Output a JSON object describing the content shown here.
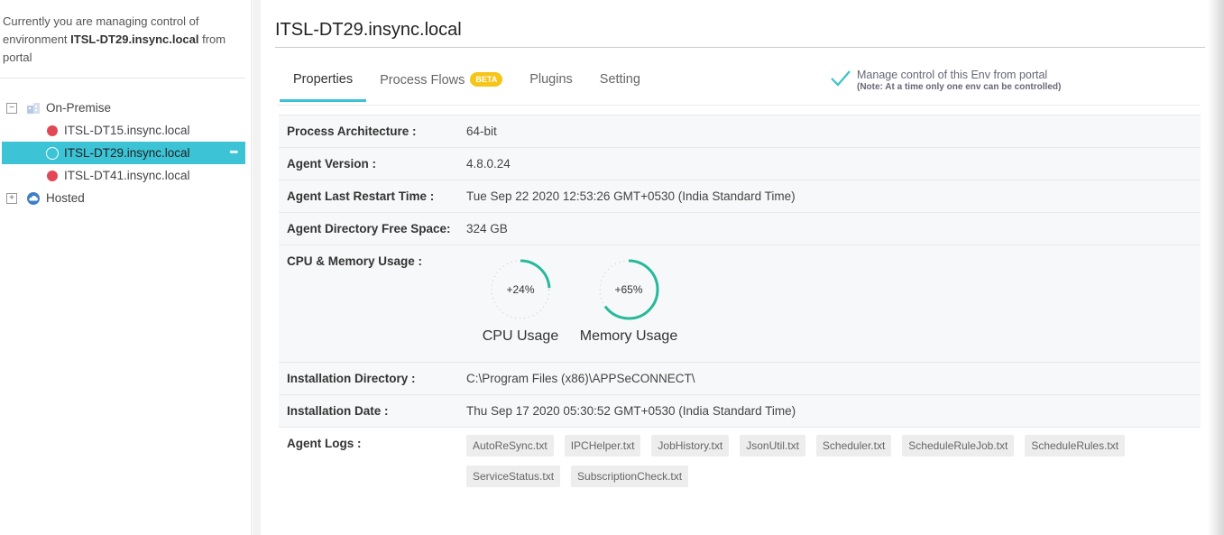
{
  "sidebar": {
    "note_prefix": "Currently you are managing control of environment ",
    "note_env": "ITSL-DT29.insync.local",
    "note_suffix": " from portal",
    "groups": [
      {
        "label": "On-Premise",
        "toggle": "−",
        "icon": "building-icon"
      },
      {
        "label": "Hosted",
        "toggle": "+",
        "icon": "cloud-icon"
      }
    ],
    "envs": [
      {
        "label": "ITSL-DT15.insync.local",
        "status": "offline",
        "color": "#e04856"
      },
      {
        "label": "ITSL-DT29.insync.local",
        "status": "selected"
      },
      {
        "label": "ITSL-DT41.insync.local",
        "status": "offline",
        "color": "#e04856"
      }
    ],
    "more_icon": "•••"
  },
  "main": {
    "title": "ITSL-DT29.insync.local",
    "tabs": [
      {
        "label": "Properties",
        "active": true
      },
      {
        "label": "Process Flows",
        "badge": "BETA"
      },
      {
        "label": "Plugins"
      },
      {
        "label": "Setting"
      }
    ],
    "manage": {
      "label": "Manage control of this Env from portal",
      "note": "(Note: At a time only one env can be controlled)",
      "checked": true
    },
    "properties": {
      "process_arch": {
        "key": "Process Architecture :",
        "value": "64-bit"
      },
      "agent_version": {
        "key": "Agent Version :",
        "value": "4.8.0.24"
      },
      "restart_time": {
        "key": "Agent Last Restart Time :",
        "value": "Tue Sep 22 2020 12:53:26 GMT+0530 (India Standard Time)"
      },
      "free_space": {
        "key": "Agent Directory Free Space:",
        "value": "324 GB"
      },
      "usage": {
        "key": "CPU & Memory Usage :",
        "cpu": {
          "label": "CPU Usage",
          "text": "+24%",
          "percent": 24
        },
        "memory": {
          "label": "Memory Usage",
          "text": "+65%",
          "percent": 65
        }
      },
      "install_dir": {
        "key": "Installation Directory :",
        "value": "C:\\Program Files (x86)\\APPSeCONNECT\\"
      },
      "install_date": {
        "key": "Installation Date :",
        "value": "Thu Sep 17 2020 05:30:52 GMT+0530 (India Standard Time)"
      },
      "logs": {
        "key": "Agent Logs :",
        "files": [
          "AutoReSync.txt",
          "IPCHelper.txt",
          "JobHistory.txt",
          "JsonUtil.txt",
          "Scheduler.txt",
          "ScheduleRuleJob.txt",
          "ScheduleRules.txt",
          "ServiceStatus.txt",
          "SubscriptionCheck.txt"
        ]
      }
    }
  },
  "colors": {
    "accent": "#3cc3d6",
    "gauge": "#26b99a",
    "offline": "#e04856",
    "beta": "#f5c518"
  }
}
